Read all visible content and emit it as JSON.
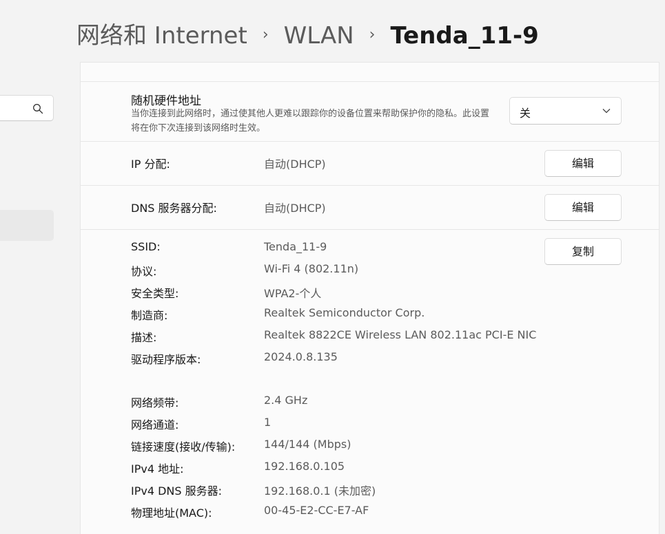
{
  "breadcrumb": [
    {
      "label": "网络和 Internet"
    },
    {
      "label": "WLAN"
    },
    {
      "label": "Tenda_11-9"
    }
  ],
  "sidebar": {
    "search": {
      "value": ""
    }
  },
  "random_mac": {
    "title": "随机硬件地址",
    "description": "当你连接到此网络时，通过使其他人更难以跟踪你的设备位置来帮助保护你的隐私。此设置将在你下次连接到该网络时生效。",
    "selected": "关"
  },
  "ip_assignment": {
    "label": "IP 分配:",
    "value": "自动(DHCP)",
    "button": "编辑"
  },
  "dns_assignment": {
    "label": "DNS 服务器分配:",
    "value": "自动(DHCP)",
    "button": "编辑"
  },
  "copy_button": "复制",
  "properties": [
    {
      "label": "SSID:",
      "value": "Tenda_11-9"
    },
    {
      "label": "协议:",
      "value": "Wi-Fi 4 (802.11n)"
    },
    {
      "label": "安全类型:",
      "value": "WPA2-个人"
    },
    {
      "label": "制造商:",
      "value": "Realtek Semiconductor Corp."
    },
    {
      "label": "描述:",
      "value": "Realtek 8822CE Wireless LAN 802.11ac PCI-E NIC"
    },
    {
      "label": "驱动程序版本:",
      "value": "2024.0.8.135"
    },
    {
      "label": "网络频带:",
      "value": "2.4 GHz"
    },
    {
      "label": "网络通道:",
      "value": "1"
    },
    {
      "label": "链接速度(接收/传输):",
      "value": "144/144 (Mbps)"
    },
    {
      "label": "IPv4 地址:",
      "value": "192.168.0.105"
    },
    {
      "label": "IPv4 DNS 服务器:",
      "value": "192.168.0.1 (未加密)"
    },
    {
      "label": "物理地址(MAC):",
      "value": "00-45-E2-CC-E7-AF"
    }
  ]
}
